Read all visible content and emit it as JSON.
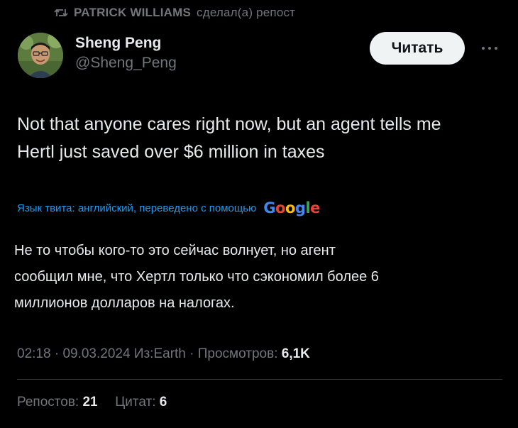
{
  "repost": {
    "icon": "repost-icon",
    "user": "PATRICK WILLIAMS",
    "suffix": "сделал(а) репост"
  },
  "author": {
    "avatar": "avatar-photo",
    "display_name": "Sheng Peng",
    "handle": "@Sheng_Peng"
  },
  "follow_button": "Читать",
  "more_icon": "more-icon",
  "tweet": {
    "text_line1": "Not that anyone cares right now, but an agent tells me",
    "text_line2": "Hertl just saved over $6 million in taxes"
  },
  "translation": {
    "note": "Язык твита: английский, переведено с помощью",
    "provider": "Google",
    "line1": "Не то чтобы кого-то это сейчас волнует, но агент",
    "line2": "сообщил мне, что Хертл только что сэкономил более 6",
    "line3": "миллионов долларов на налогах."
  },
  "meta": {
    "time": "02:18",
    "date": "09.03.2024",
    "source": "Из:Earth",
    "views_label": "Просмотров:",
    "views_count": "6,1K"
  },
  "stats": {
    "reposts_label": "Репостов:",
    "reposts_count": "21",
    "quotes_label": "Цитат:",
    "quotes_count": "6"
  },
  "colors": {
    "background": "#000000",
    "text": "#e7e9ea",
    "muted": "#71767b",
    "link": "#1d9bf0",
    "button_bg": "#eff3f4"
  }
}
